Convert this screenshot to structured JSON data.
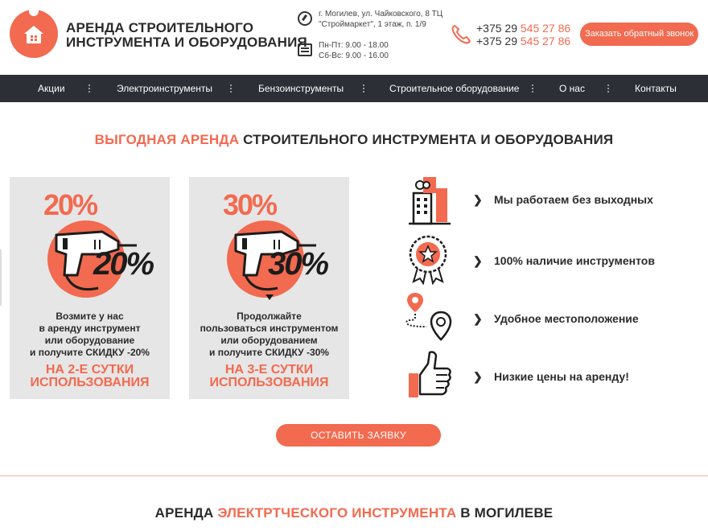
{
  "header": {
    "logo_line1": "АРЕНДА СТРОИТЕЛЬНОГО",
    "logo_line2": "ИНСТРУМЕНТА И ОБОРУДОВАНИЯ",
    "address_line1": "г. Могилев, ул. Чайковского, 8 ТЦ",
    "address_line2": "\"Строймаркет\", 1 этаж, п. 1/9",
    "hours_line1": "Пн-Пт: 9.00 - 18.00",
    "hours_line2": "Сб-Вс: 9.00 - 16.00",
    "phone1_prefix": "+375 29 ",
    "phone1_number": "545 27 86",
    "phone2_prefix": "+375 29 ",
    "phone2_number": "545 27 86",
    "callback_label": "Заказать обратный звонок"
  },
  "nav": {
    "items": [
      {
        "label": "Акции"
      },
      {
        "label": "Электроинструменты"
      },
      {
        "label": "Бензоинструменты"
      },
      {
        "label": "Строительное оборудование"
      },
      {
        "label": "О нас"
      },
      {
        "label": "Контакты"
      }
    ]
  },
  "section": {
    "title_highlight": "ВЫГОДНАЯ АРЕНДА",
    "title_rest": " СТРОИТЕЛЬНОГО ИНСТРУМЕНТА И ОБОРУДОВАНИЯ"
  },
  "cards": [
    {
      "percent": "20%",
      "ghost_percent": "20%",
      "caption_line1": "Возмите у нас",
      "caption_line2": "в аренду инструмент",
      "caption_line3": "или оборудование",
      "caption_line4": "и получите СКИДКУ -20%",
      "promo_line1": "НА 2-Е СУТКИ",
      "promo_line2": "ИСПОЛЬЗОВАНИЯ"
    },
    {
      "percent": "30%",
      "ghost_percent": "30%",
      "caption_line1": "Продолжайте",
      "caption_line2": "пользоваться инструментом",
      "caption_line3": "или оборудованием",
      "caption_line4": "и получите СКИДКУ -30%",
      "promo_line1": "НА 3-Е СУТКИ",
      "promo_line2": "ИСПОЛЬЗОВАНИЯ"
    }
  ],
  "features": [
    {
      "label": "Мы работаем без выходных",
      "icon": "buildings-icon"
    },
    {
      "label": "100% наличие инструментов",
      "icon": "badge-star-icon"
    },
    {
      "label": "Удобное местоположение",
      "icon": "map-route-icon"
    },
    {
      "label": "Низкие цены на аренду!",
      "icon": "thumbs-up-icon"
    }
  ],
  "cta_label": "ОСТАВИТЬ ЗАЯВКУ",
  "bottom": {
    "title_part1": "АРЕНДА ",
    "title_highlight": "ЭЛЕКТРТЧЕСКОГО ИНСТРУМЕНТА",
    "title_part2": " В МОГИЛЕВЕ"
  },
  "colors": {
    "accent": "#f26a4f",
    "nav_bg": "#2c2f36",
    "card_bg": "#e6e6e6"
  }
}
